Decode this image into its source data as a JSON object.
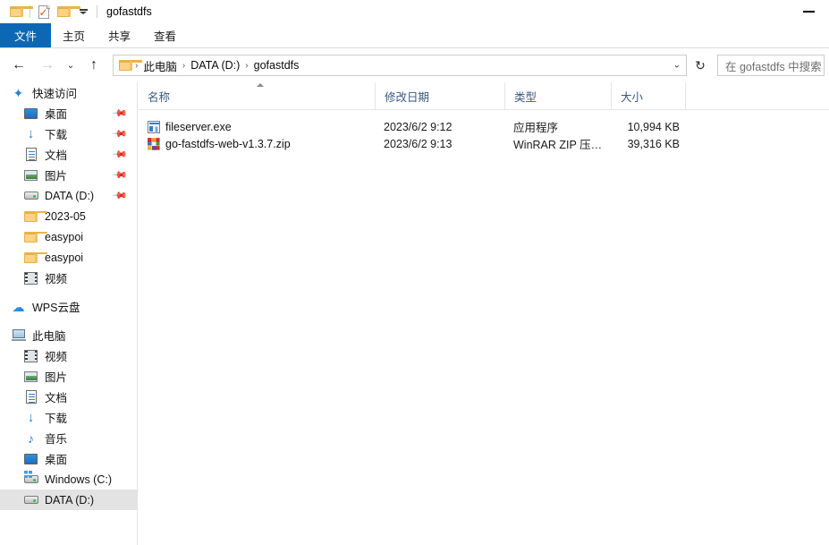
{
  "window": {
    "title": "gofastdfs",
    "minimize_label": "—"
  },
  "quick_access_toolbar": {
    "folder_icon": "folder-icon",
    "properties_icon": "properties-checkmark-icon",
    "new_folder_icon": "new-folder-icon",
    "customize_icon": "customize-dropdown-icon"
  },
  "ribbon": {
    "tabs": [
      {
        "label": "文件",
        "active": true
      },
      {
        "label": "主页",
        "active": false
      },
      {
        "label": "共享",
        "active": false
      },
      {
        "label": "查看",
        "active": false
      }
    ],
    "active_tab_color": "#0c68b5"
  },
  "navigation": {
    "back": "←",
    "forward": "→",
    "recent": "⌄",
    "up": "↑",
    "refresh": "↻",
    "dropdown": "⌄",
    "breadcrumb": [
      "此电脑",
      "DATA (D:)",
      "gofastdfs"
    ],
    "separator": "›"
  },
  "search": {
    "placeholder": "在 gofastdfs 中搜索"
  },
  "sidebar": {
    "groups": [
      {
        "name": "quick-access",
        "header": {
          "label": "快速访问",
          "icon": "star-pin-icon"
        },
        "items": [
          {
            "label": "桌面",
            "icon": "desktop-icon",
            "pinned": true
          },
          {
            "label": "下载",
            "icon": "download-icon",
            "pinned": true
          },
          {
            "label": "文档",
            "icon": "documents-icon",
            "pinned": true
          },
          {
            "label": "图片",
            "icon": "pictures-icon",
            "pinned": true
          },
          {
            "label": "DATA (D:)",
            "icon": "drive-icon",
            "pinned": true
          },
          {
            "label": "2023-05",
            "icon": "folder-icon",
            "pinned": false
          },
          {
            "label": "easypoi",
            "icon": "folder-icon",
            "pinned": false
          },
          {
            "label": "easypoi",
            "icon": "folder-icon",
            "pinned": false
          },
          {
            "label": "视频",
            "icon": "videos-icon",
            "pinned": false
          }
        ]
      },
      {
        "name": "wps-cloud",
        "header": {
          "label": "WPS云盘",
          "icon": "cloud-icon"
        },
        "items": []
      },
      {
        "name": "this-pc",
        "header": {
          "label": "此电脑",
          "icon": "computer-icon"
        },
        "items": [
          {
            "label": "视频",
            "icon": "videos-icon",
            "selected": false
          },
          {
            "label": "图片",
            "icon": "pictures-icon",
            "selected": false
          },
          {
            "label": "文档",
            "icon": "documents-icon",
            "selected": false
          },
          {
            "label": "下载",
            "icon": "download-icon",
            "selected": false
          },
          {
            "label": "音乐",
            "icon": "music-icon",
            "selected": false
          },
          {
            "label": "桌面",
            "icon": "desktop-icon",
            "selected": false
          },
          {
            "label": "Windows (C:)",
            "icon": "windows-drive-icon",
            "selected": false
          },
          {
            "label": "DATA (D:)",
            "icon": "drive-icon",
            "selected": true
          }
        ]
      }
    ],
    "selected_bg": "#e3e3e3"
  },
  "file_list": {
    "columns": [
      {
        "key": "name",
        "label": "名称",
        "sorted": "asc"
      },
      {
        "key": "date",
        "label": "修改日期",
        "sorted": ""
      },
      {
        "key": "type",
        "label": "类型",
        "sorted": ""
      },
      {
        "key": "size",
        "label": "大小",
        "sorted": ""
      }
    ],
    "rows": [
      {
        "name": "fileserver.exe",
        "icon": "exe-application-icon",
        "date": "2023/6/2 9:12",
        "type": "应用程序",
        "size": "10,994 KB"
      },
      {
        "name": "go-fastdfs-web-v1.3.7.zip",
        "icon": "winrar-zip-icon",
        "date": "2023/6/2 9:13",
        "type": "WinRAR ZIP 压缩...",
        "size": "39,316 KB"
      }
    ]
  }
}
